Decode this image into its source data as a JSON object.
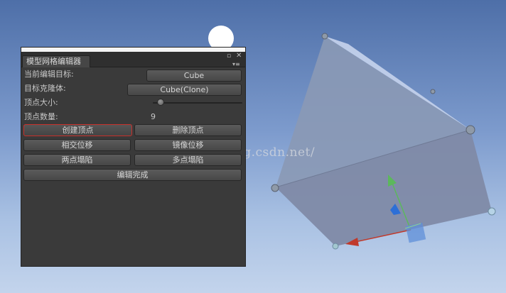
{
  "window": {
    "tab_title": "模型网格编辑器",
    "menu_icon": "menu-lines-icon",
    "maximize_icon": "maximize-icon",
    "close_icon": "close-icon"
  },
  "fields": {
    "target_label": "当前编辑目标:",
    "target_value": "Cube",
    "clone_label": "目标克隆体:",
    "clone_value": "Cube(Clone)",
    "vertex_size_label": "顶点大小:",
    "vertex_size_value": 0.05,
    "vertex_count_label": "顶点数量:",
    "vertex_count_value": "9"
  },
  "buttons": {
    "create_vertex": "创建顶点",
    "delete_vertex": "删除顶点",
    "intersect_move": "相交位移",
    "mirror_move": "镜像位移",
    "two_point_collapse": "两点塌陷",
    "multi_point_collapse": "多点塌陷",
    "edit_done": "编辑完成"
  },
  "watermark": "http://blog.csdn.net/",
  "colors": {
    "background_top": "#4e6fa8",
    "background_bottom": "#c3d4ec",
    "window_bg": "#3a3a3a",
    "selected_outline": "#c8302b",
    "gizmo_x": "#c0392b",
    "gizmo_y": "#5cb85c",
    "gizmo_z": "#2d6fd6"
  }
}
